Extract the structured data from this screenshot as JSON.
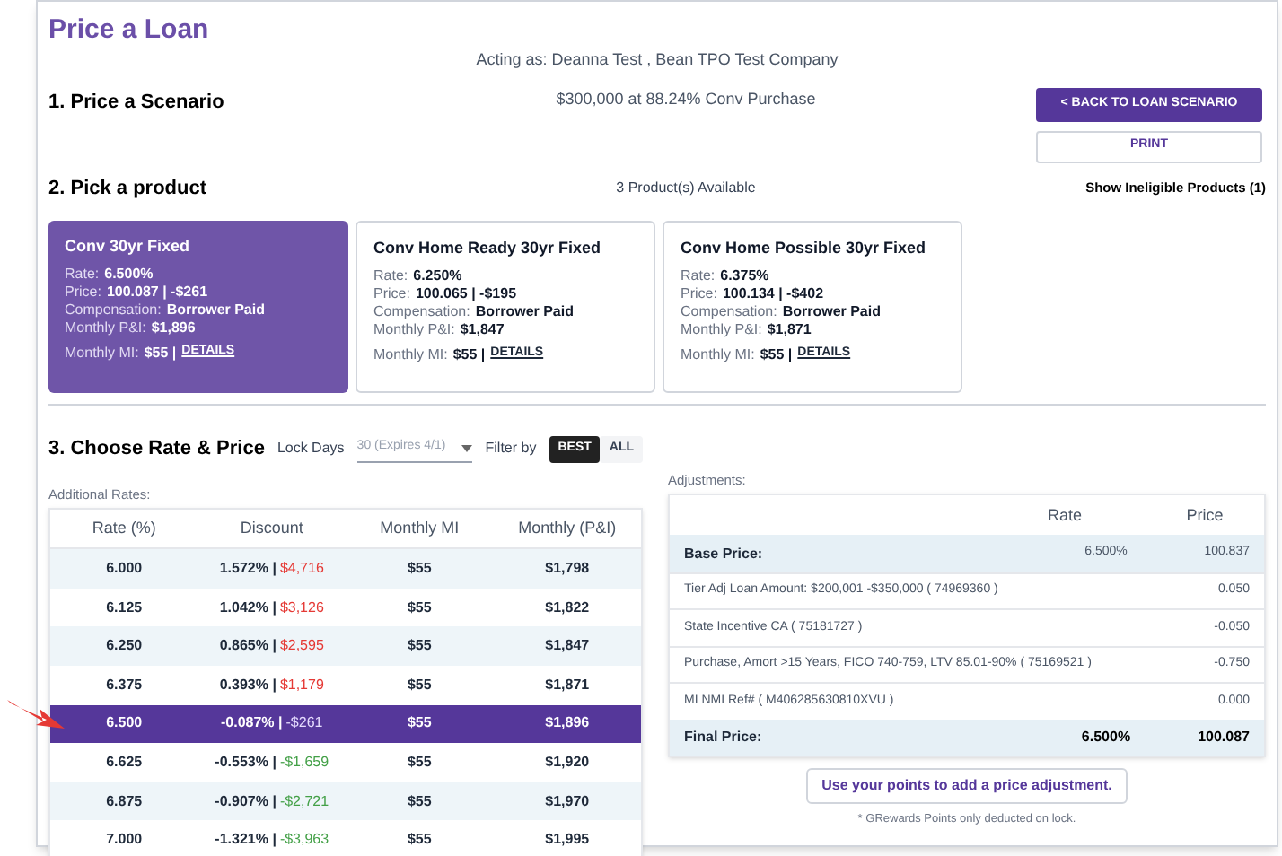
{
  "title": "Price a Loan",
  "acting_as": "Acting as: Deanna Test , Bean TPO Test Company",
  "scenario": {
    "heading": "1. Price a Scenario",
    "summary": "$300,000 at 88.24% Conv Purchase",
    "back_button": "< BACK TO LOAN SCENARIO",
    "print_button": "PRINT"
  },
  "products": {
    "heading": "2. Pick a product",
    "available": "3 Product(s) Available",
    "ineligible_link": "Show Ineligible Products (1)",
    "cards": [
      {
        "name": "Conv 30yr Fixed",
        "selected": true,
        "rate_label": "Rate:",
        "rate": "6.500%",
        "price_label": "Price:",
        "price": "100.087 | -$261",
        "comp_label": "Compensation:",
        "comp": "Borrower Paid",
        "pi_label": "Monthly P&I:",
        "pi": "$1,896",
        "mi_label": "Monthly MI:",
        "mi": "$55 |",
        "details": "DETAILS"
      },
      {
        "name": "Conv Home Ready 30yr Fixed",
        "selected": false,
        "rate_label": "Rate:",
        "rate": "6.250%",
        "price_label": "Price:",
        "price": "100.065 | -$195",
        "comp_label": "Compensation:",
        "comp": "Borrower Paid",
        "pi_label": "Monthly P&I:",
        "pi": "$1,847",
        "mi_label": "Monthly MI:",
        "mi": "$55 |",
        "details": "DETAILS"
      },
      {
        "name": "Conv Home Possible 30yr Fixed",
        "selected": false,
        "rate_label": "Rate:",
        "rate": "6.375%",
        "price_label": "Price:",
        "price": "100.134 | -$402",
        "comp_label": "Compensation:",
        "comp": "Borrower Paid",
        "pi_label": "Monthly P&I:",
        "pi": "$1,871",
        "mi_label": "Monthly MI:",
        "mi": "$55 |",
        "details": "DETAILS"
      }
    ]
  },
  "rates": {
    "heading": "3. Choose Rate & Price",
    "lock_label": "Lock Days",
    "lock_value": "30 (Expires 4/1)",
    "filter_label": "Filter by",
    "filters": [
      {
        "label": "BEST",
        "selected": true
      },
      {
        "label": "ALL",
        "selected": false
      }
    ],
    "table_title": "Additional Rates:",
    "columns": [
      "Rate (%)",
      "Discount",
      "Monthly MI",
      "Monthly (P&I)"
    ],
    "rows": [
      {
        "rate": "6.000",
        "discount": "1.572% |",
        "amount": "$4,716",
        "kind": "cost",
        "mi": "$55",
        "pi": "$1,798",
        "selected": false
      },
      {
        "rate": "6.125",
        "discount": "1.042% |",
        "amount": "$3,126",
        "kind": "cost",
        "mi": "$55",
        "pi": "$1,822",
        "selected": false
      },
      {
        "rate": "6.250",
        "discount": "0.865% |",
        "amount": "$2,595",
        "kind": "cost",
        "mi": "$55",
        "pi": "$1,847",
        "selected": false
      },
      {
        "rate": "6.375",
        "discount": "0.393% |",
        "amount": "$1,179",
        "kind": "cost",
        "mi": "$55",
        "pi": "$1,871",
        "selected": false
      },
      {
        "rate": "6.500",
        "discount": "-0.087% |",
        "amount": "-$261",
        "kind": "credit",
        "mi": "$55",
        "pi": "$1,896",
        "selected": true
      },
      {
        "rate": "6.625",
        "discount": "-0.553% |",
        "amount": "-$1,659",
        "kind": "credit",
        "mi": "$55",
        "pi": "$1,920",
        "selected": false
      },
      {
        "rate": "6.875",
        "discount": "-0.907% |",
        "amount": "-$2,721",
        "kind": "credit",
        "mi": "$55",
        "pi": "$1,970",
        "selected": false
      },
      {
        "rate": "7.000",
        "discount": "-1.321% |",
        "amount": "-$3,963",
        "kind": "credit",
        "mi": "$55",
        "pi": "$1,995",
        "selected": false
      }
    ]
  },
  "adjustments": {
    "title": "Adjustments:",
    "columns": [
      "Rate",
      "Price"
    ],
    "rows": [
      {
        "kind": "base",
        "label": "Base Price:",
        "rate": "6.500%",
        "price": "100.837"
      },
      {
        "kind": "item",
        "label": "Tier Adj Loan Amount: $200,001 -$350,000 ( 74969360 )",
        "price": "0.050"
      },
      {
        "kind": "item",
        "label": "State Incentive CA ( 75181727 )",
        "price": "-0.050"
      },
      {
        "kind": "item",
        "label": "Purchase, Amort >15 Years, FICO 740-759, LTV 85.01-90% ( 75169521 )",
        "price": "-0.750"
      },
      {
        "kind": "item",
        "label": "MI NMI Ref# ( M406285630810XVU )",
        "price": "0.000"
      },
      {
        "kind": "final",
        "label": "Final Price:",
        "rate": "6.500%",
        "price": "100.087"
      }
    ],
    "points_button": "Use your points to add a price adjustment.",
    "footnote": "* GRewards Points only deducted on lock."
  }
}
